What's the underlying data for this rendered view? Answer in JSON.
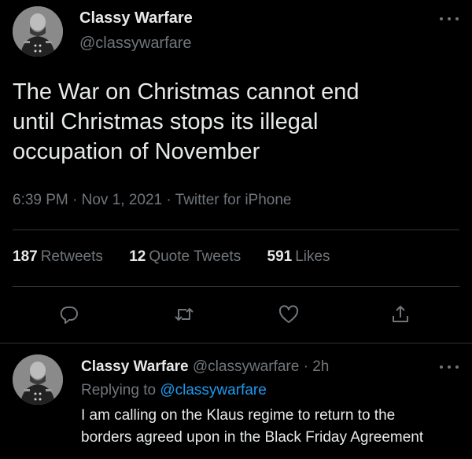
{
  "tweet": {
    "author_name": "Classy Warfare",
    "author_handle": "@classywarfare",
    "text_lines": [
      "The War on Christmas cannot end",
      "until Christmas stops its illegal",
      "occupation of November"
    ],
    "meta": "6:39 PM · Nov 1, 2021 · Twitter for iPhone",
    "stats": {
      "retweets_count": "187",
      "retweets_label": "Retweets",
      "quotes_count": "12",
      "quotes_label": "Quote Tweets",
      "likes_count": "591",
      "likes_label": "Likes"
    },
    "actions": [
      "reply-icon",
      "retweet-icon",
      "like-icon",
      "share-icon"
    ]
  },
  "reply": {
    "author_name": "Classy Warfare",
    "author_handle": "@classywarfare",
    "time": "· 2h",
    "replying_prefix": "Replying to",
    "replying_handle": "@classywarfare",
    "text_lines": [
      "I am calling on the Klaus regime to return to the",
      "borders agreed upon in the Black Friday Agreement"
    ]
  },
  "colors": {
    "background": "#000000",
    "text": "#e7e9ea",
    "muted": "#71767b",
    "link": "#1d9bf0",
    "divider": "#2f3336"
  }
}
